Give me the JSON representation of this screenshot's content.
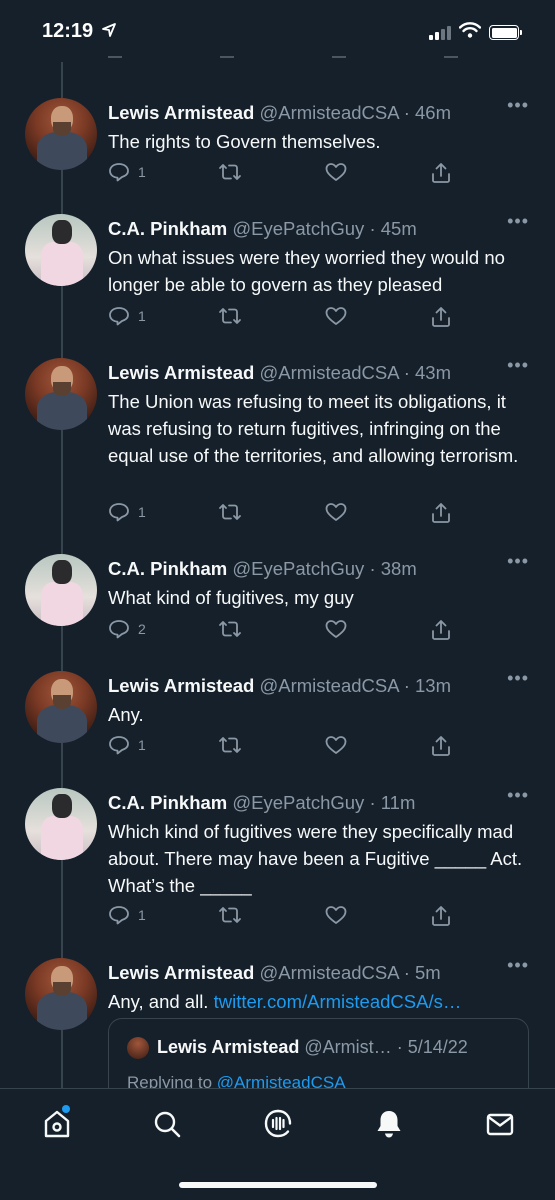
{
  "status_bar": {
    "time": "12:19",
    "location_icon": "location-arrow-icon",
    "signal_icon": "cellular-signal-icon",
    "wifi_icon": "wifi-icon",
    "battery_icon": "battery-icon"
  },
  "colors": {
    "background": "#15202b",
    "text": "#f7f9f9",
    "muted": "#8b98a5",
    "accent": "#1d9bf0",
    "divider": "#38444d"
  },
  "tweets": [
    {
      "name": "Lewis Armistead",
      "handle": "@ArmisteadCSA",
      "time": "· 46m",
      "text": "The rights to Govern themselves.",
      "reply_count": "1",
      "avatar": "armistead"
    },
    {
      "name": "C.A. Pinkham",
      "handle": "@EyePatchGuy",
      "time": "· 45m",
      "text": "On what issues were they worried they would no longer be able to govern as they pleased",
      "reply_count": "1",
      "avatar": "pinkham"
    },
    {
      "name": "Lewis Armistead",
      "handle": "@ArmisteadCSA",
      "time": "· 43m",
      "text": "The Union was refusing to meet its obligations, it was refusing to return fugitives, infringing on the equal use of the territories, and allowing terrorism.",
      "reply_count": "1",
      "avatar": "armistead"
    },
    {
      "name": "C.A. Pinkham",
      "handle": "@EyePatchGuy",
      "time": "· 38m",
      "text": "What kind of fugitives, my guy",
      "reply_count": "2",
      "avatar": "pinkham"
    },
    {
      "name": "Lewis Armistead",
      "handle": "@ArmisteadCSA",
      "time": "· 13m",
      "text": "Any.",
      "reply_count": "1",
      "avatar": "armistead"
    },
    {
      "name": "C.A. Pinkham",
      "handle": "@EyePatchGuy",
      "time": "· 11m",
      "text": "Which kind of fugitives were they specifically mad about. There may have been a Fugitive _____ Act. What’s the _____",
      "reply_count": "1",
      "avatar": "pinkham"
    },
    {
      "name": "Lewis Armistead",
      "handle": "@ArmisteadCSA",
      "time": "· 5m",
      "text": "Any, and all.",
      "link": "twitter.com/ArmisteadCSA/s…",
      "avatar": "armistead",
      "quote": {
        "name": "Lewis Armistead",
        "handle": "@Armist…",
        "time": "· 5/14/22",
        "reply_prefix": "Replying to",
        "reply_handle": "@ArmisteadCSA"
      }
    }
  ],
  "more_label": "•••",
  "tab_bar": {
    "items": [
      "home-icon",
      "search-icon",
      "spaces-icon",
      "notifications-icon",
      "messages-icon"
    ]
  }
}
